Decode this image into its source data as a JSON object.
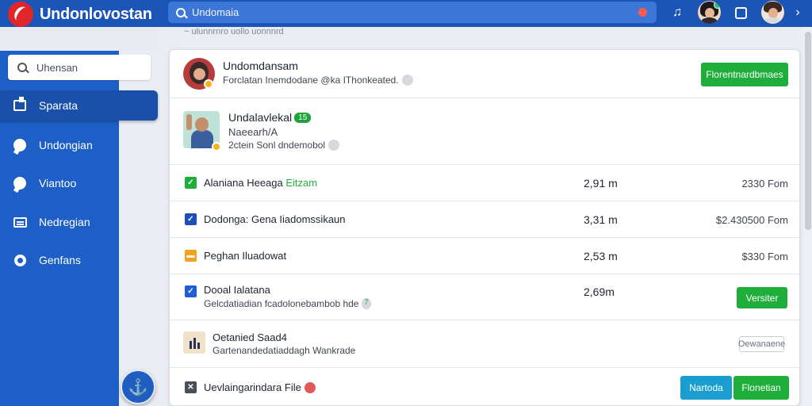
{
  "app": {
    "title": "Undonlovostan"
  },
  "topbar": {
    "search_value": "Undomaia",
    "icons": [
      "music-note-icon",
      "avatar",
      "square-icon",
      "avatar",
      "chevron-right-icon"
    ]
  },
  "sidebar": {
    "search_placeholder": "Uhensan",
    "items": [
      {
        "label": "Sparata",
        "icon": "book-icon",
        "active": true
      },
      {
        "label": "Undongian",
        "icon": "chat-bubble-icon",
        "active": false
      },
      {
        "label": "Viantoo",
        "icon": "comment-icon",
        "active": false
      },
      {
        "label": "Nedregian",
        "icon": "message-icon",
        "active": false
      },
      {
        "label": "Genfans",
        "icon": "gear-icon",
        "active": false
      }
    ],
    "fab_icon": "anchor-icon"
  },
  "breadcrumb": "~ ulunnrnro uollo uonnnrd",
  "profile": {
    "name": "Undomdansam",
    "subtitle": "Forclatan Inemdodane @ka IThonkeated.",
    "button": "Florentnardbmaes"
  },
  "featured": {
    "name": "Undalavlekal",
    "badge": "15",
    "line2": "Naeearh/A",
    "line3": "2ctein Sonl dndemobol"
  },
  "rows": [
    {
      "title": "Alaniana Heeaga",
      "highlight": "Eitzam",
      "num": "2,91 m",
      "price": "2330 Fom",
      "check_color": "#1fae3a"
    },
    {
      "title": "Dodonga: Gena Iiadomssikaun",
      "highlight": "",
      "num": "3,31 m",
      "price": "$2.430500 Fom",
      "check_color": "#1e4fb8"
    },
    {
      "title": "Peghan Iluadowat",
      "highlight": "",
      "num": "2,53 m",
      "price": "$330 Fom",
      "check_color": "#f2a31b"
    },
    {
      "title": "Dooal Ialatana",
      "sub": "Gelcdatiadian fcadolonebambob hde",
      "sub_badge": "7",
      "num": "2,69m",
      "button": "Versiter",
      "check_color": "#1e5fd6"
    }
  ],
  "connected": {
    "title": "Oetanied Saad4",
    "sub": "Gartenandedatiaddagh Wankrade",
    "button": "Oewanaene"
  },
  "footer": {
    "title": "Uevlaingarindara File",
    "btn1": "Nartoda",
    "btn2": "Flonetian"
  },
  "colors": {
    "topbar": "#1b55b8",
    "sidebar": "#1d5fc7",
    "accent_green": "#1fae3a",
    "accent_teal": "#1a9ecf",
    "logo_red": "#e0262b"
  }
}
